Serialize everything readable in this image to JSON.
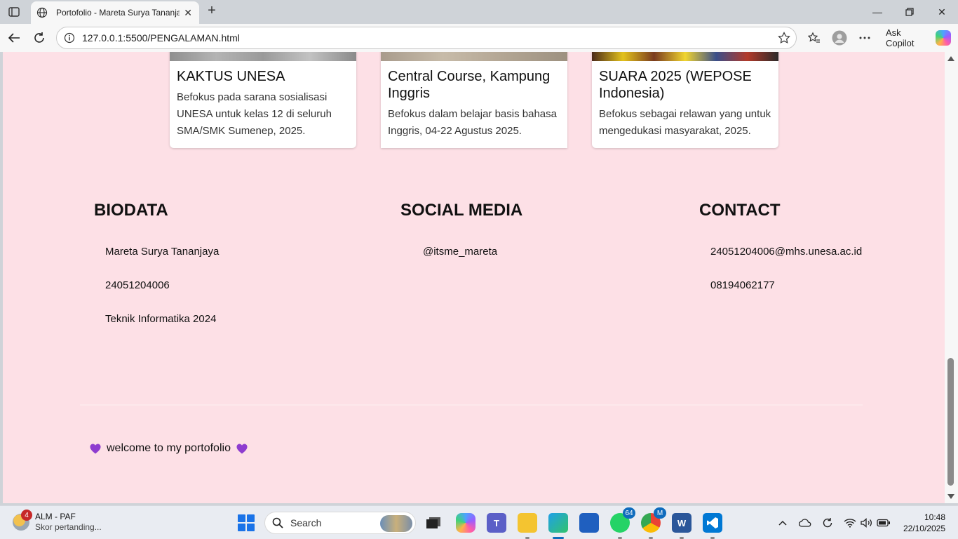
{
  "browser": {
    "tab_title": "Portofolio - Mareta Surya Tananjaya",
    "url": "127.0.0.1:5500/PENGALAMAN.html",
    "copilot_label": "Ask Copilot"
  },
  "experience": {
    "cards": [
      {
        "title": "KAKTUS UNESA",
        "desc": "Befokus pada sarana sosialisasi UNESA untuk kelas 12 di seluruh SMA/SMK Sumenep, 2025."
      },
      {
        "title": "Central Course, Kampung Inggris",
        "desc": "Befokus dalam belajar basis bahasa Inggris, 04-22 Agustus 2025."
      },
      {
        "title": "SUARA 2025 (WEPOSE Indonesia)",
        "desc": "Befokus sebagai relawan yang untuk mengedukasi masyarakat, 2025."
      }
    ]
  },
  "biodata": {
    "title": "BIODATA",
    "name": "Mareta Surya Tananjaya",
    "nim": "24051204006",
    "program": "Teknik Informatika 2024"
  },
  "social": {
    "title": "SOCIAL MEDIA",
    "handle": "@itsme_mareta"
  },
  "contact": {
    "title": "CONTACT",
    "email": "24051204006@mhs.unesa.ac.id",
    "phone": "08194062177"
  },
  "footer": {
    "text": "welcome to my portofolio"
  },
  "taskbar": {
    "weather_badge": "4",
    "weather_title": "ALM - PAF",
    "weather_sub": "Skor pertanding...",
    "search_placeholder": "Search",
    "whatsapp_badge": "64",
    "chrome_badge": "M",
    "time": "10:48",
    "date": "22/10/2025"
  },
  "colors": {
    "page_bg": "#fde0e6",
    "heart": "#8e3ccf",
    "accent": "#0f6cbd"
  }
}
